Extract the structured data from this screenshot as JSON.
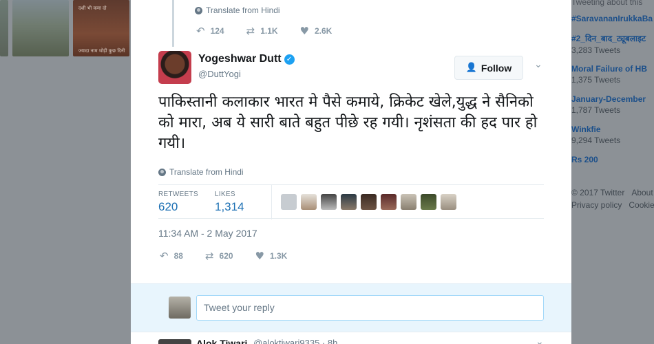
{
  "background": {
    "thumb_captions": [
      "दशी भी कमा दो",
      "ज्यादा नाम थोड़ी कुछ दिनी"
    ],
    "right_panel": {
      "header": "Tweeting about this",
      "trends": [
        {
          "name": "#SaravananIrukkaBa",
          "count": ""
        },
        {
          "name": "#2_दिन_बाद_ट्यूबलाइट",
          "count": "3,283 Tweets"
        },
        {
          "name": "Moral Failure of HB",
          "count": "1,375 Tweets"
        },
        {
          "name": "January-December",
          "count": "1,787 Tweets"
        },
        {
          "name": "Winkfie",
          "count": "9,294 Tweets"
        },
        {
          "name": "Rs 200",
          "count": ""
        }
      ],
      "footer_line1": [
        "© 2017 Twitter",
        "About"
      ],
      "footer_line2": [
        "Privacy policy",
        "Cookies"
      ]
    }
  },
  "quoted_tweet": {
    "translate": "Translate from Hindi",
    "actions": {
      "reply": "124",
      "retweet": "1.1K",
      "like": "2.6K"
    }
  },
  "tweet": {
    "author_name": "Yogeshwar Dutt",
    "verified_mark": "✓",
    "handle": "@DuttYogi",
    "follow_label": "Follow",
    "text": "पाकिस्तानी कलाकार भारत मे पैसे कमाये, क्रिकेट खेले,युद्ध ने सैनिको को मारा, अब ये सारी बाते बहुत पीछे रह गयी। नृशंसता की हद पार हो गयी।",
    "translate": "Translate from Hindi",
    "stats": {
      "retweets_label": "RETWEETS",
      "retweets": "620",
      "likes_label": "LIKES",
      "likes": "1,314"
    },
    "timestamp": "11:34 AM - 2 May 2017",
    "actions": {
      "reply": "88",
      "retweet": "620",
      "like": "1.3K"
    }
  },
  "reply": {
    "placeholder": "Tweet your reply"
  },
  "next_reply": {
    "name": "Alok Tiwari",
    "handle": "@aloktiwari9335 · 8h"
  },
  "colors": {
    "accent": "#1da1f2",
    "link": "#1b6fb3",
    "muted": "#657786"
  },
  "icons": [
    "globe-icon",
    "reply-icon",
    "retweet-icon",
    "heart-icon",
    "follow-user-icon",
    "verified-icon",
    "chevron-down-icon"
  ]
}
